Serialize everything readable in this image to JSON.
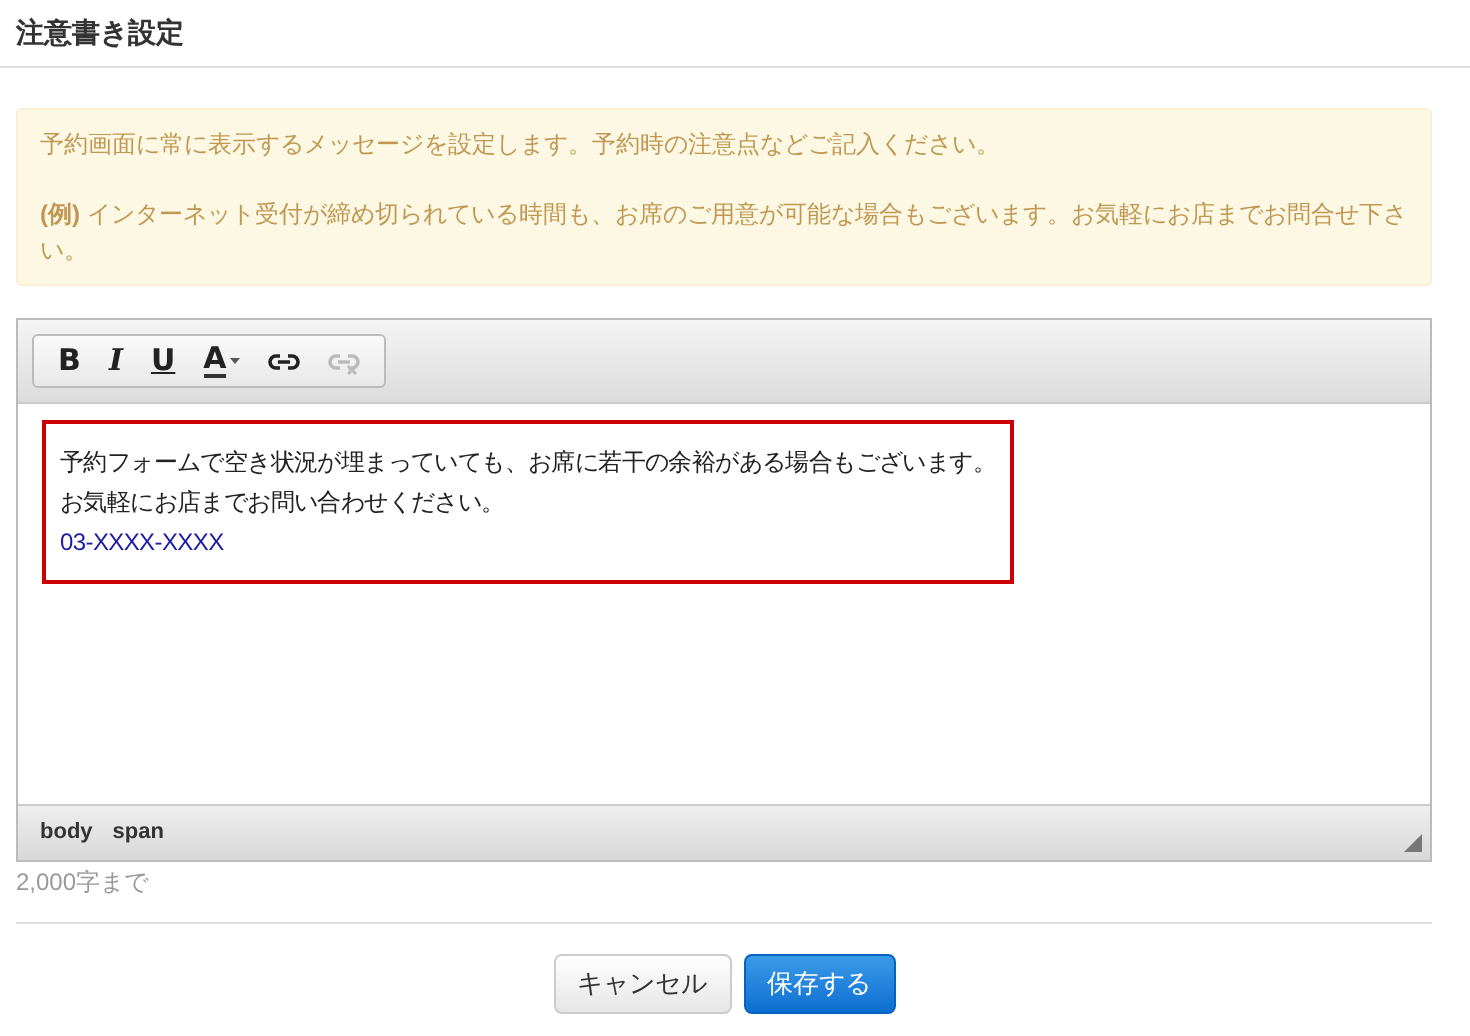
{
  "title": "注意書き設定",
  "notice": {
    "paragraphs": [
      "予約画面に常に表示するメッセージを設定します。予約時の注意点などご記入ください。",
      "**(例)** インターネット受付が締め切られている時間も、お席のご用意が可能な場合もございます。お気軽にお店までお問合せ下さい。"
    ]
  },
  "editor": {
    "toolbar": [
      {
        "kind": "bold",
        "label": "B",
        "disabled": false
      },
      {
        "kind": "italic",
        "label": "I",
        "disabled": false
      },
      {
        "kind": "underline",
        "label": "U",
        "disabled": false
      },
      {
        "kind": "color",
        "label": "A",
        "disabled": false
      },
      {
        "kind": "link",
        "disabled": false
      },
      {
        "kind": "unlink",
        "disabled": true
      }
    ],
    "highlighted": true,
    "lines": [
      {
        "kind": "text",
        "text": "予約フォームで空き状況が埋まっていても、お席に若干の余裕がある場合もございます。"
      },
      {
        "kind": "text",
        "text": "お気軽にお店までお問い合わせください。"
      },
      {
        "kind": "phone",
        "text": "03-XXXX-XXXX"
      }
    ],
    "path": [
      "body",
      "span"
    ]
  },
  "char_limit": "2,000字まで",
  "buttons": [
    {
      "kind": "default",
      "label": "キャンセル"
    },
    {
      "kind": "primary",
      "label": "保存する"
    }
  ]
}
